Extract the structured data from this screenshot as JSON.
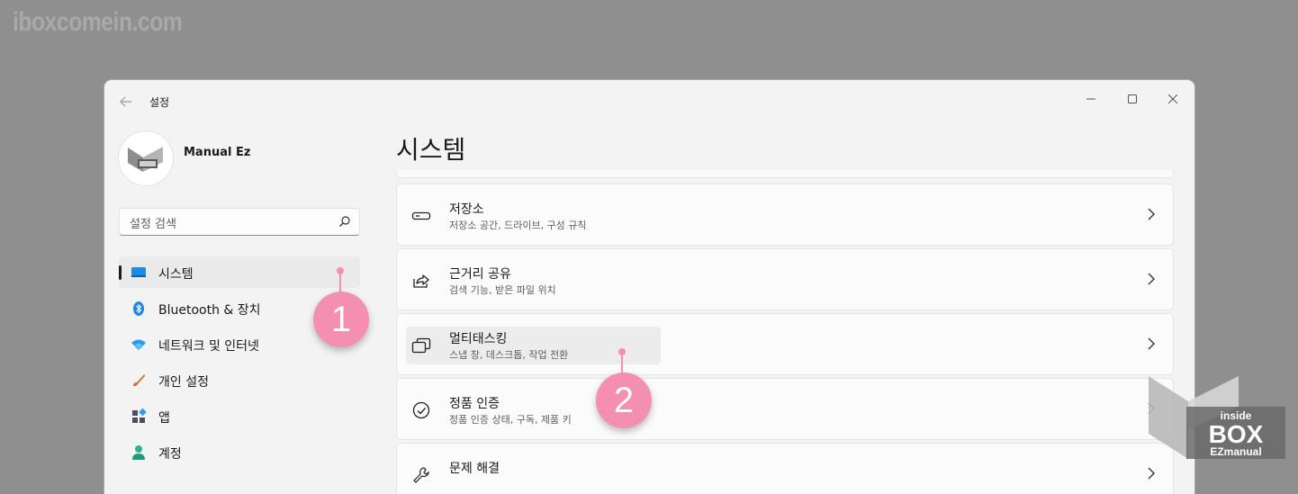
{
  "watermark": {
    "text": "iboxcomein.com"
  },
  "window": {
    "title": "설정"
  },
  "user": {
    "name": "Manual Ez"
  },
  "search": {
    "placeholder": "설정 검색"
  },
  "sidebar": {
    "items": [
      {
        "label": "시스템",
        "icon": "monitor-icon",
        "active": true
      },
      {
        "label": "Bluetooth & 장치",
        "icon": "bluetooth-icon"
      },
      {
        "label": "네트워크 및 인터넷",
        "icon": "wifi-icon"
      },
      {
        "label": "개인 설정",
        "icon": "brush-icon"
      },
      {
        "label": "앱",
        "icon": "apps-icon"
      },
      {
        "label": "계정",
        "icon": "person-icon"
      }
    ]
  },
  "main": {
    "title": "시스템",
    "cards": [
      {
        "title": "저장소",
        "subtitle": "저장소 공간, 드라이브, 구성 규칙",
        "icon": "storage-icon"
      },
      {
        "title": "근거리 공유",
        "subtitle": "검색 기능, 받은 파일 위치",
        "icon": "share-icon"
      },
      {
        "title": "멀티태스킹",
        "subtitle": "스냅 창, 데스크톱, 작업 전환",
        "icon": "multitasking-icon",
        "highlighted": true
      },
      {
        "title": "정품 인증",
        "subtitle": "정품 인증 상태, 구독, 제품 키",
        "icon": "activation-check-icon"
      },
      {
        "title": "문제 해결",
        "subtitle": "",
        "icon": "troubleshoot-icon"
      }
    ]
  },
  "annotations": {
    "step1": "1",
    "step2": "2"
  },
  "logo": {
    "line1": "inside",
    "line2": "BOX",
    "line3": "EZmanual"
  },
  "colors": {
    "background": "#8f8f8f",
    "window": "#f3f3f3",
    "card": "#fbfbfb",
    "marker": "#f48fb1",
    "accent": "#0078d4"
  }
}
